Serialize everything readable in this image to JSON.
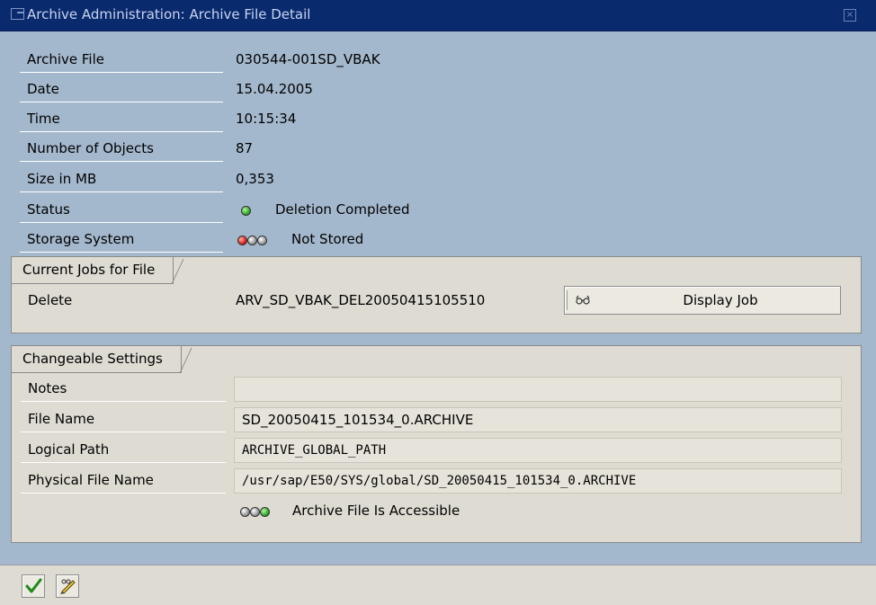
{
  "window": {
    "title": "Archive Administration: Archive File Detail"
  },
  "details": [
    {
      "label": "Archive File",
      "value": "030544-001SD_VBAK"
    },
    {
      "label": "Date",
      "value": "15.04.2005"
    },
    {
      "label": "Time",
      "value": "10:15:34"
    },
    {
      "label": "Number of Objects",
      "value": "87"
    },
    {
      "label": "Size in MB",
      "value": "0,353"
    },
    {
      "label": "Status",
      "value": "Deletion Completed"
    },
    {
      "label": "Storage System",
      "value": "Not Stored"
    }
  ],
  "current_jobs": {
    "tab_label": "Current Jobs for File",
    "job_type": "Delete",
    "job_name": "ARV_SD_VBAK_DEL20050415105510",
    "button_label": "Display Job"
  },
  "settings": {
    "tab_label": "Changeable Settings",
    "fields": [
      {
        "label": "Notes",
        "value": ""
      },
      {
        "label": "File Name",
        "value": "SD_20050415_101534_0.ARCHIVE"
      },
      {
        "label": "Logical Path",
        "value": "ARCHIVE_GLOBAL_PATH"
      },
      {
        "label": "Physical File Name",
        "value": "/usr/sap/E50/SYS/global/SD_20050415_101534_0.ARCHIVE"
      }
    ],
    "accessibility": "Archive File Is Accessible"
  },
  "icons": {
    "status_led": "green-led-icon",
    "storage_leds": [
      "red-led-icon",
      "gray-led-icon",
      "gray-led-icon"
    ],
    "access_leds": [
      "gray-led-icon",
      "gray-led-icon",
      "green-led-icon"
    ],
    "continue": "checkmark-icon",
    "edit": "pencil-icon"
  },
  "colors": {
    "background": "#a4b8cd",
    "titlebar": "#0a2a6e",
    "group_panel": "#dedbd2",
    "led_green": "#1e9d1e",
    "led_red": "#d01010"
  }
}
